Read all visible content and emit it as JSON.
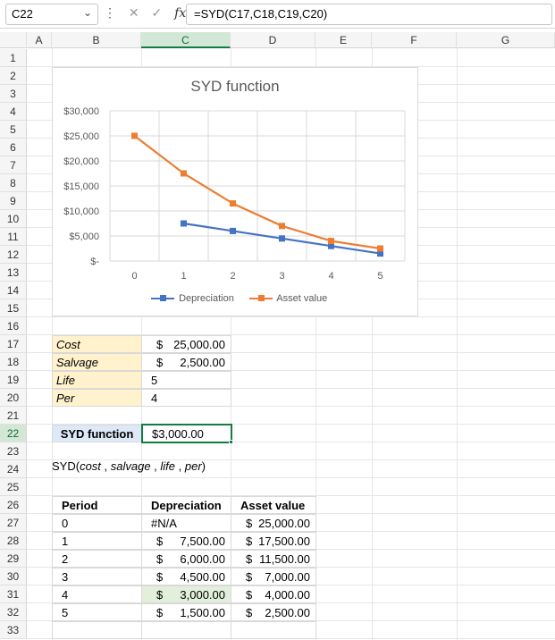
{
  "formula_bar": {
    "name_box": "C22",
    "formula": "=SYD(C17,C18,C19,C20)",
    "fx_label": "fx",
    "cancel_glyph": "✕",
    "enter_glyph": "✓",
    "more_glyph": "⋮",
    "dropdown_glyph": "⌄"
  },
  "columns": [
    "A",
    "B",
    "C",
    "D",
    "E",
    "F",
    "G"
  ],
  "selected_column": "C",
  "rows": [
    "1",
    "2",
    "3",
    "4",
    "5",
    "6",
    "7",
    "8",
    "9",
    "10",
    "11",
    "12",
    "13",
    "14",
    "15",
    "16",
    "17",
    "18",
    "19",
    "20",
    "21",
    "22",
    "23",
    "24",
    "25",
    "26",
    "27",
    "28",
    "29",
    "30",
    "31",
    "32",
    "33"
  ],
  "selected_row": "22",
  "chart_data": {
    "type": "line",
    "title": "SYD function",
    "x": [
      0,
      1,
      2,
      3,
      4,
      5
    ],
    "x_tick_labels": [
      "0",
      "1",
      "2",
      "3",
      "4",
      "5"
    ],
    "y_tick_labels": [
      "$30,000",
      "$25,000",
      "$20,000",
      "$15,000",
      "$10,000",
      "$5,000",
      "$-"
    ],
    "ylim": [
      0,
      30000
    ],
    "grid": true,
    "legend_position": "bottom",
    "series": [
      {
        "name": "Depreciation",
        "color": "#4472c4",
        "x": [
          1,
          2,
          3,
          4,
          5
        ],
        "values": [
          7500,
          6000,
          4500,
          3000,
          1500
        ]
      },
      {
        "name": "Asset value",
        "color": "#ed7d31",
        "x": [
          0,
          1,
          2,
          3,
          4,
          5
        ],
        "values": [
          25000,
          17500,
          11500,
          7000,
          4000,
          2500
        ]
      }
    ]
  },
  "inputs": {
    "cost_label": "Cost",
    "cost_sym": "$",
    "cost_value": "25,000.00",
    "salvage_label": "Salvage",
    "salvage_sym": "$",
    "salvage_value": "2,500.00",
    "life_label": "Life",
    "life_value": "5",
    "per_label": "Per",
    "per_value": "4"
  },
  "result": {
    "label": "SYD function",
    "value": "$3,000.00"
  },
  "syntax": {
    "prefix": "SYD(",
    "arg1": "cost",
    "sep1": " , ",
    "arg2": "salvage",
    "sep2": " , ",
    "arg3": "life",
    "sep3": " , ",
    "arg4": "per",
    "suffix": ")"
  },
  "table": {
    "headers": [
      "Period",
      "Depreciation",
      "Asset value"
    ],
    "rows": [
      {
        "period": "0",
        "dep_sym": "",
        "dep": "#N/A",
        "av_sym": "$",
        "av": "25,000.00"
      },
      {
        "period": "1",
        "dep_sym": "$",
        "dep": "7,500.00",
        "av_sym": "$",
        "av": "17,500.00"
      },
      {
        "period": "2",
        "dep_sym": "$",
        "dep": "6,000.00",
        "av_sym": "$",
        "av": "11,500.00"
      },
      {
        "period": "3",
        "dep_sym": "$",
        "dep": "4,500.00",
        "av_sym": "$",
        "av": "7,000.00"
      },
      {
        "period": "4",
        "dep_sym": "$",
        "dep": "3,000.00",
        "av_sym": "$",
        "av": "4,000.00"
      },
      {
        "period": "5",
        "dep_sym": "$",
        "dep": "1,500.00",
        "av_sym": "$",
        "av": "2,500.00"
      }
    ]
  }
}
